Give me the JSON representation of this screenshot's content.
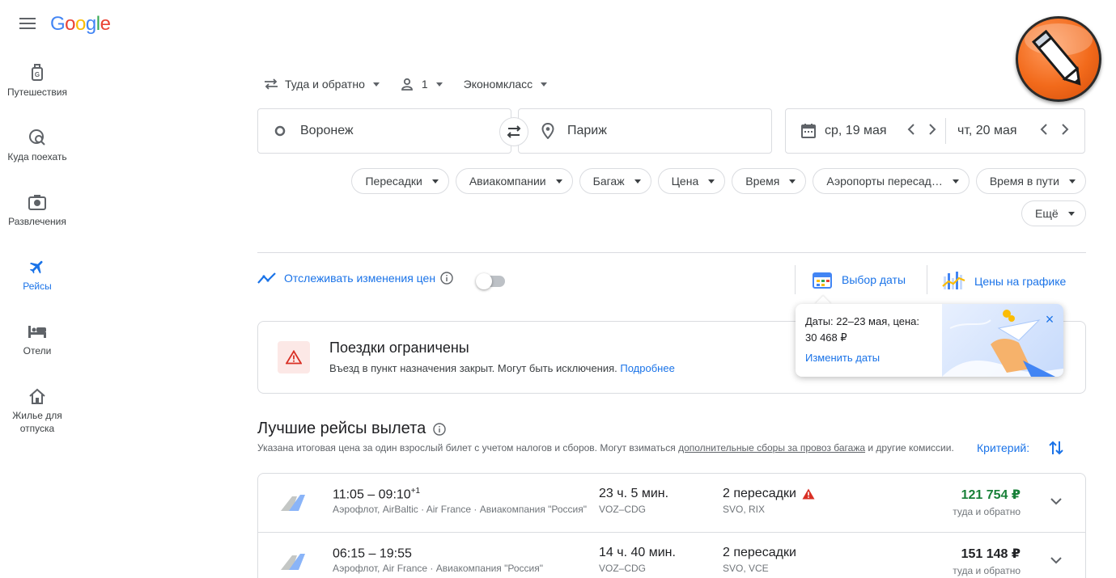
{
  "header": {
    "logo_parts": [
      "G",
      "o",
      "o",
      "g",
      "l",
      "e"
    ]
  },
  "sidebar": {
    "items": [
      {
        "label": "Путешествия"
      },
      {
        "label": "Куда поехать"
      },
      {
        "label": "Развлечения"
      },
      {
        "label": "Рейсы"
      },
      {
        "label": "Отели"
      },
      {
        "label": "Жилье для отпуска"
      }
    ]
  },
  "search": {
    "trip_type": "Туда и обратно",
    "passengers": "1",
    "cabin": "Экономкласс",
    "from": "Воронеж",
    "to": "Париж",
    "depart": "ср, 19 мая",
    "return": "чт, 20 мая"
  },
  "filters": {
    "chips": [
      "Пересадки",
      "Авиакомпании",
      "Багаж",
      "Цена",
      "Время",
      "Аэропорты пересад…",
      "Время в пути"
    ],
    "more": "Ещё"
  },
  "tracking": {
    "label": "Отслеживать изменения цен",
    "date_picker": "Выбор даты",
    "price_graph": "Цены на графике"
  },
  "popup": {
    "text_line1": "Даты: 22–23 мая, цена:",
    "text_line2": "30 468 ₽",
    "link": "Изменить даты"
  },
  "restriction": {
    "title": "Поездки ограничены",
    "text": "Въезд в пункт назначения закрыт. Могут быть исключения.",
    "link": "Подробнее"
  },
  "results": {
    "title": "Лучшие рейсы вылета",
    "note_before": "Указана итоговая цена за один взрослый билет с учетом налогов и сборов. Могут взиматься ",
    "note_link": "дополнительные сборы за провоз багажа",
    "note_after": " и другие комиссии.",
    "sort_label": "Критерий:",
    "flights": [
      {
        "times": "11:05 – 09:10",
        "day_offset": "+1",
        "airlines": "Аэрофлот, AirBaltic · Air France · Авиакомпания \"Россия\"",
        "duration": "23 ч. 5 мин.",
        "route": "VOZ–CDG",
        "stops": "2 пересадки",
        "via": "SVO, RIX",
        "price": "121 754 ₽",
        "price_type": "туда и обратно"
      },
      {
        "times": "06:15 – 19:55",
        "day_offset": "",
        "airlines": "Аэрофлот, Air France · Авиакомпания \"Россия\"",
        "duration": "14 ч. 40 мин.",
        "route": "VOZ–CDG",
        "stops": "2 пересадки",
        "via": "SVO, VCE",
        "price": "151 148 ₽",
        "price_type": "туда и обратно"
      }
    ]
  },
  "colors": {
    "accent": "#1a73e8",
    "good_price": "#188038",
    "warning": "#d93025"
  }
}
